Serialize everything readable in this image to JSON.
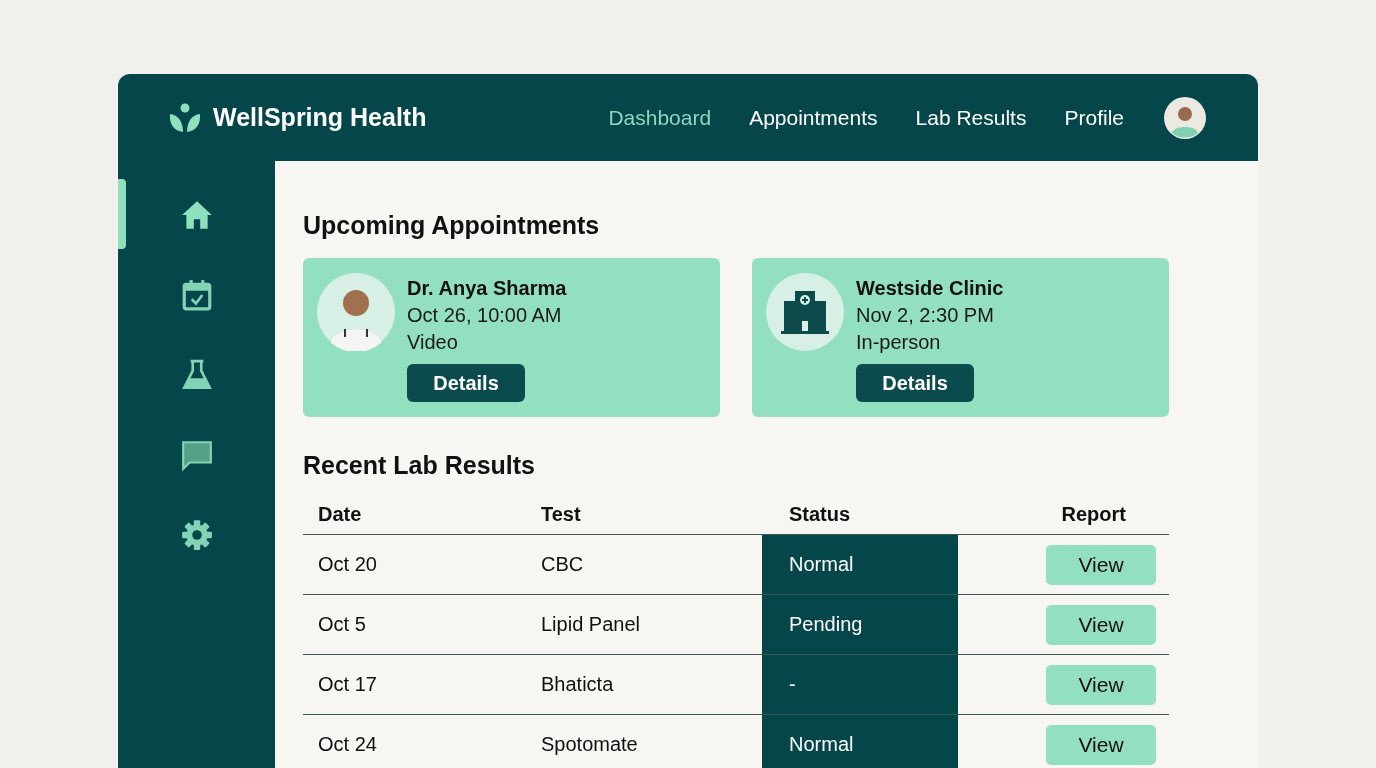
{
  "brand": {
    "name": "WellSpring Health"
  },
  "nav": [
    {
      "label": "Dashboard",
      "selected": true
    },
    {
      "label": "Appointments",
      "selected": false
    },
    {
      "label": "Lab Results",
      "selected": false
    },
    {
      "label": "Profile",
      "selected": false
    }
  ],
  "sidebar": {
    "items": [
      {
        "kind": "home",
        "selected": true
      },
      {
        "kind": "calendar",
        "selected": false
      },
      {
        "kind": "flask",
        "selected": false
      },
      {
        "kind": "chat",
        "selected": false
      },
      {
        "kind": "settings",
        "selected": false
      }
    ]
  },
  "appointments": {
    "title": "Upcoming Appointments",
    "cards": [
      {
        "kind": "doctor",
        "name": "Dr. Anya Sharma",
        "time": "Oct 26, 10:00 AM",
        "mode": "Video",
        "button": "Details"
      },
      {
        "kind": "clinic",
        "name": "Westside Clinic",
        "time": "Nov 2, 2:30 PM",
        "mode": "In-person",
        "button": "Details"
      }
    ]
  },
  "lab_results": {
    "title": "Recent Lab Results",
    "columns": [
      "Date",
      "Test",
      "Status",
      "Report"
    ],
    "rows": [
      {
        "date": "Oct 20",
        "test": "CBC",
        "status": "Normal",
        "report": "View"
      },
      {
        "date": "Oct 5",
        "test": "Lipid Panel",
        "status": "Pending",
        "report": "View"
      },
      {
        "date": "Oct 17",
        "test": "Bhaticta",
        "status": "-",
        "report": "View"
      },
      {
        "date": "Oct 24",
        "test": "Spotomate",
        "status": "Normal",
        "report": "View"
      }
    ]
  }
}
